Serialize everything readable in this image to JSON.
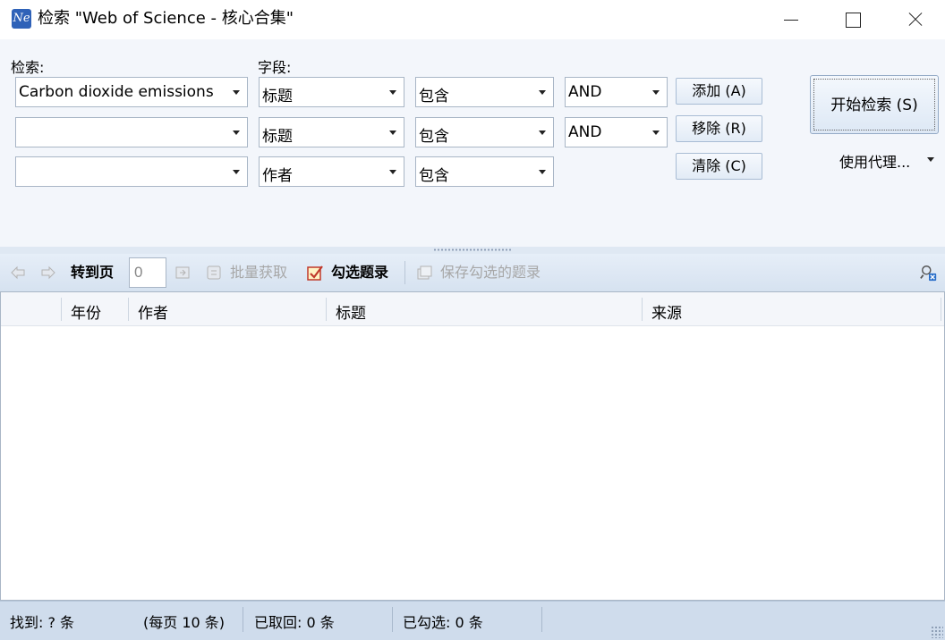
{
  "window": {
    "icon_text": "Ne",
    "title": "检索 \"Web of Science - 核心合集\""
  },
  "search": {
    "label_search": "检索:",
    "label_field": "字段:",
    "rows": [
      {
        "term": "Carbon dioxide emissions",
        "field": "标题",
        "match": "包含",
        "operator": "AND"
      },
      {
        "term": "",
        "field": "标题",
        "match": "包含",
        "operator": "AND"
      },
      {
        "term": "",
        "field": "作者",
        "match": "包含"
      }
    ],
    "add_label": "添加 (A)",
    "remove_label": "移除 (R)",
    "clear_label": "清除 (C)",
    "start_label": "开始检索 (S)",
    "proxy_label": "使用代理..."
  },
  "toolbar": {
    "goto_label": "转到页",
    "page_value": "0",
    "batch_label": "批量获取",
    "check_label": "勾选题录",
    "save_label": "保存勾选的题录"
  },
  "grid": {
    "columns": [
      "年份",
      "作者",
      "标题",
      "来源"
    ]
  },
  "status": {
    "found": "找到: ? 条",
    "per_page": "(每页 10 条)",
    "retrieved": "已取回: 0 条",
    "checked": "已勾选: 0 条"
  },
  "colors": {
    "accent": "#2f62b8",
    "panel_bg": "#f3f6fb",
    "toolbar_bg": "#dbe5f2",
    "status_bg": "#cfdcec"
  }
}
